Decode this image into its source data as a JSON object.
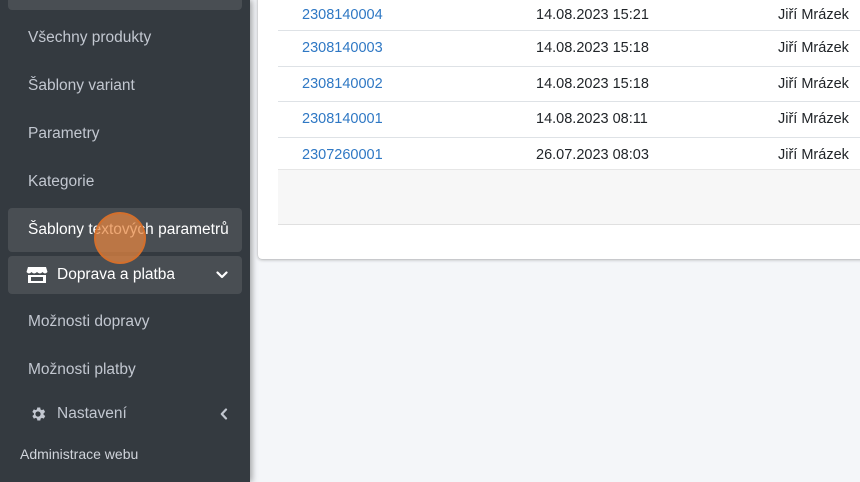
{
  "sidebar": {
    "items": [
      {
        "label": "Všechny produkty"
      },
      {
        "label": "Šablony variant"
      },
      {
        "label": "Parametry"
      },
      {
        "label": "Kategorie"
      },
      {
        "label": "Šablony textových parametrů"
      }
    ],
    "shipping_group": {
      "label": "Doprava a platba",
      "icon": "store-icon"
    },
    "shipping_items": [
      {
        "label": "Možnosti dopravy"
      },
      {
        "label": "Možnosti platby"
      }
    ],
    "settings": {
      "label": "Nastavení",
      "icon": "gear-icon"
    },
    "section_header": "Administrace webu"
  },
  "table": {
    "rows": [
      {
        "number": "2308140004",
        "date": "14.08.2023 15:21",
        "user": "Jiří Mrázek"
      },
      {
        "number": "2308140003",
        "date": "14.08.2023 15:18",
        "user": "Jiří Mrázek"
      },
      {
        "number": "2308140002",
        "date": "14.08.2023 15:18",
        "user": "Jiří Mrázek"
      },
      {
        "number": "2308140001",
        "date": "14.08.2023 08:11",
        "user": "Jiří Mrázek"
      },
      {
        "number": "2307260001",
        "date": "26.07.2023 08:03",
        "user": "Jiří Mrázek"
      }
    ]
  },
  "colors": {
    "sidebar_bg": "#343a40",
    "active_bg": "#494e53",
    "link": "#2f78c4",
    "click_marker": "#e88640"
  }
}
